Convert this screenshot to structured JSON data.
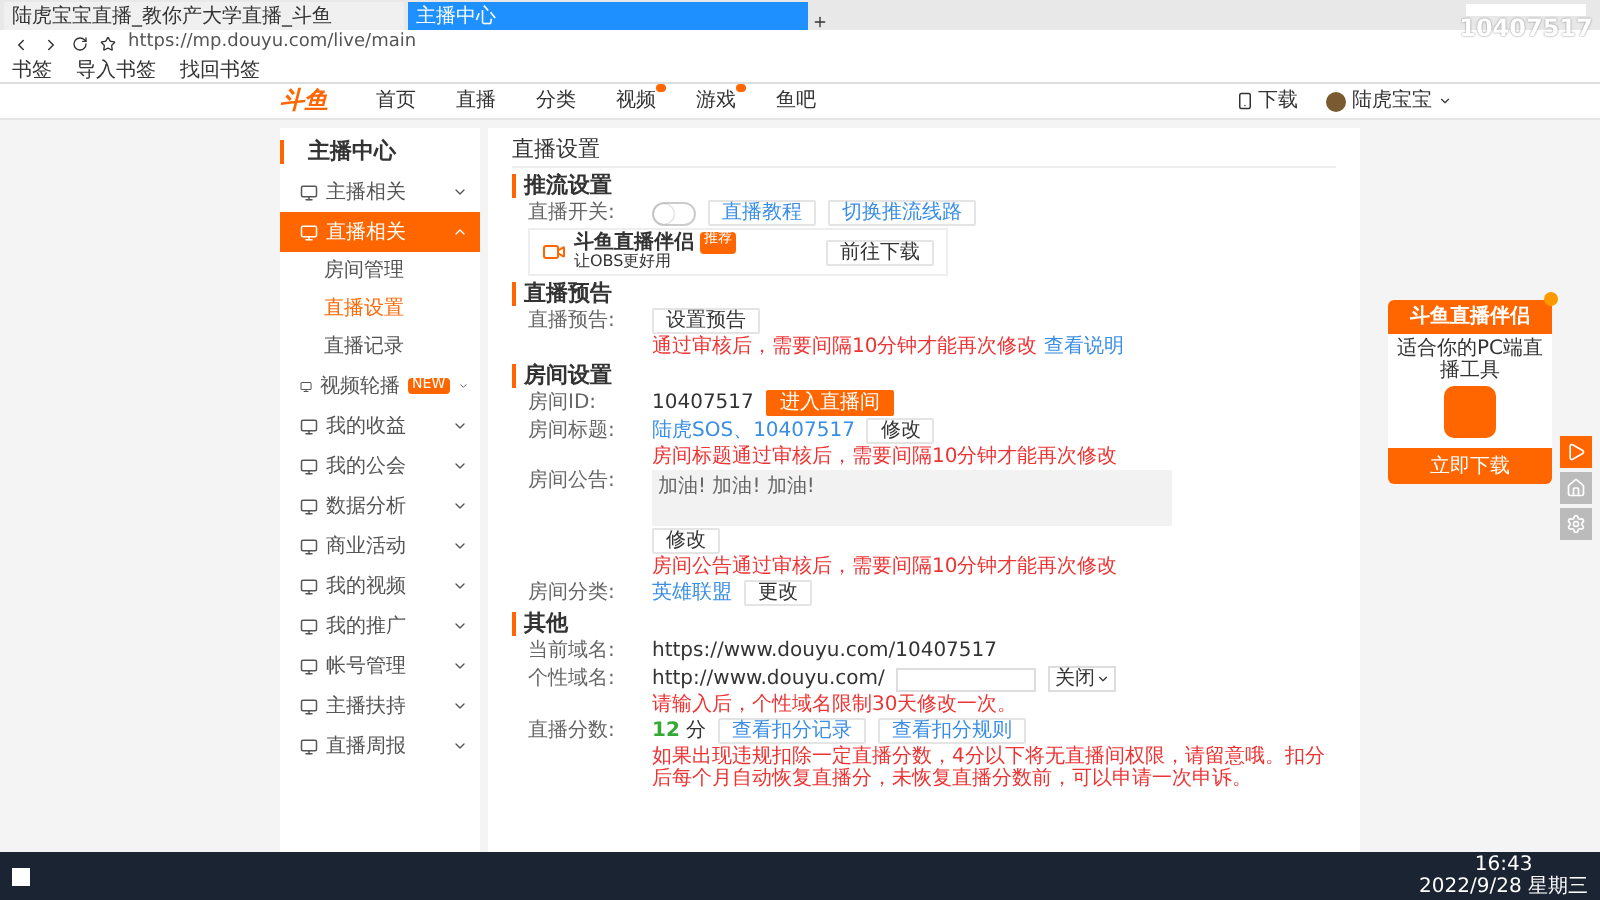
{
  "browser": {
    "tabs": [
      {
        "title": "陆虎宝宝直播_教你产大学直播_斗鱼",
        "selected": false
      },
      {
        "title": "主播中心",
        "selected": true
      }
    ],
    "url": "https://mp.douyu.com/live/main",
    "bookmarks": [
      "书签",
      "导入书签",
      "找回书签"
    ]
  },
  "overlay_id": "10407517",
  "site_nav": {
    "logo": "斗鱼",
    "items": [
      {
        "label": "首页",
        "badge": false
      },
      {
        "label": "直播",
        "badge": false
      },
      {
        "label": "分类",
        "badge": false
      },
      {
        "label": "视频",
        "badge": true
      },
      {
        "label": "游戏",
        "badge": true
      },
      {
        "label": "鱼吧",
        "badge": false
      }
    ],
    "download": "下载",
    "user": "陆虎宝宝"
  },
  "sidebar": {
    "title": "主播中心",
    "items": [
      {
        "label": "主播相关",
        "expanded": false,
        "selected": false
      },
      {
        "label": "直播相关",
        "expanded": true,
        "selected": true,
        "children": [
          {
            "label": "房间管理",
            "selected": false
          },
          {
            "label": "直播设置",
            "selected": true
          },
          {
            "label": "直播记录",
            "selected": false
          }
        ]
      },
      {
        "label": "视频轮播",
        "expanded": false,
        "selected": false,
        "tag": "NEW"
      },
      {
        "label": "我的收益",
        "expanded": false,
        "selected": false
      },
      {
        "label": "我的公会",
        "expanded": false,
        "selected": false
      },
      {
        "label": "数据分析",
        "expanded": false,
        "selected": false
      },
      {
        "label": "商业活动",
        "expanded": false,
        "selected": false
      },
      {
        "label": "我的视频",
        "expanded": false,
        "selected": false
      },
      {
        "label": "我的推广",
        "expanded": false,
        "selected": false
      },
      {
        "label": "帐号管理",
        "expanded": false,
        "selected": false
      },
      {
        "label": "主播扶持",
        "expanded": false,
        "selected": false
      },
      {
        "label": "直播周报",
        "expanded": false,
        "selected": false
      }
    ]
  },
  "page_title": "直播设置",
  "stream": {
    "heading": "推流设置",
    "switch_label": "直播开关:",
    "switch_on": false,
    "buttons": [
      "直播教程",
      "切换推流线路"
    ],
    "card": {
      "name": "斗鱼直播伴侣",
      "tag": "推荐",
      "desc": "让OBS更好用",
      "button": "前往下载"
    }
  },
  "preview": {
    "heading": "直播预告",
    "label": "直播预告:",
    "button": "设置预告",
    "note": "通过审核后，需要间隔10分钟才能再次修改",
    "link": "查看说明"
  },
  "room": {
    "heading": "房间设置",
    "id_label": "房间ID:",
    "id": "10407517",
    "enter": "进入直播间",
    "title_label": "房间标题:",
    "title": "陆虎SOS、10407517",
    "title_button": "修改",
    "title_note": "房间标题通过审核后，需要间隔10分钟才能再次修改",
    "notice_label": "房间公告:",
    "notice": "加油! 加油! 加油!",
    "notice_button": "修改",
    "notice_note": "房间公告通过审核后，需要间隔10分钟才能再次修改",
    "category_label": "房间分类:",
    "category": "英雄联盟",
    "category_button": "更改"
  },
  "other": {
    "heading": "其他",
    "domain_label": "当前域名:",
    "domain": "https://www.douyu.com/10407517",
    "custom_label": "个性域名:",
    "custom_prefix": "http://www.douyu.com/",
    "custom_select": "关闭",
    "custom_note": "请输入后，个性域名限制30天修改一次。",
    "score_label": "直播分数:",
    "score": "12",
    "score_unit": "分",
    "score_links": [
      "查看扣分记录",
      "查看扣分规则"
    ],
    "score_note": "如果出现违规扣除一定直播分数，4分以下将无直播间权限，请留意哦。扣分后每个月自动恢复直播分，未恢复直播分数前，可以申请一次申诉。"
  },
  "promo": {
    "title": "斗鱼直播伴侣",
    "desc": "适合你的PC端直播工具",
    "button": "立即下载"
  },
  "taskbar": {
    "time": "16:43",
    "date": "2022/9/28 星期三"
  }
}
